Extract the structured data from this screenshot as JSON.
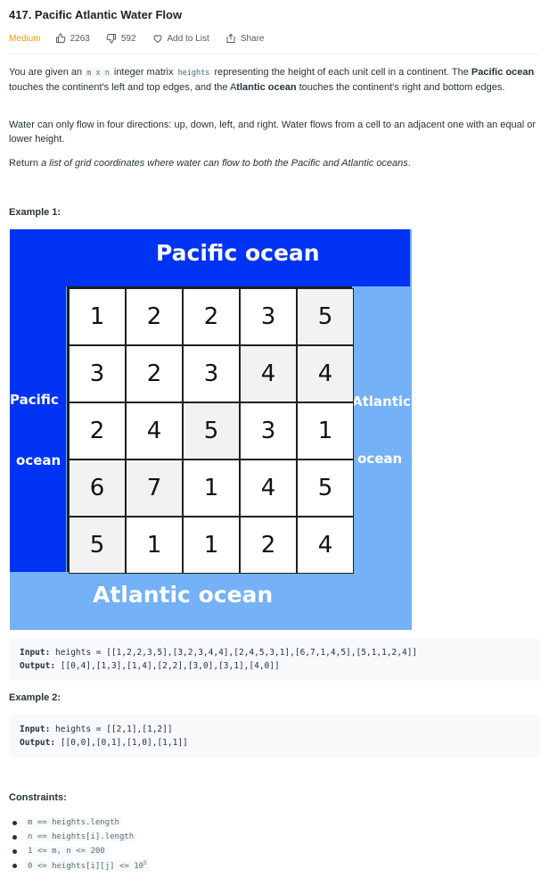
{
  "problem": {
    "title": "417. Pacific Atlantic Water Flow",
    "difficulty": "Medium",
    "likes": "2263",
    "dislikes": "592",
    "add_to_list": "Add to List",
    "share": "Share"
  },
  "description": {
    "p1": [
      {
        "t": "text",
        "v": "You are given an "
      },
      {
        "t": "code",
        "v": "m x n"
      },
      {
        "t": "text",
        "v": " integer matrix "
      },
      {
        "t": "code",
        "v": "heights"
      },
      {
        "t": "text",
        "v": " representing the height of each unit cell in a continent. The "
      },
      {
        "t": "bold",
        "v": "Pacific ocean"
      },
      {
        "t": "text",
        "v": " touches the continent's left and top edges, and the A"
      },
      {
        "t": "bold",
        "v": "tlantic ocean"
      },
      {
        "t": "text",
        "v": " touches the continent's right and bottom edges."
      }
    ],
    "p2": "Water can only flow in four directions: up, down, left, and right. Water flows from a cell to an adjacent one with an equal or lower height.",
    "p3_prefix": "Return ",
    "p3_italic": "a list of grid coordinates where water can flow to both the Pacific and Atlantic oceans",
    "p3_suffix": "."
  },
  "example1": {
    "title": "Example 1:",
    "figure": {
      "pacific_top": "Pacific ocean",
      "atlantic_bottom": "Atlantic ocean",
      "pacific_left_1": "Pacific",
      "pacific_left_2": "ocean",
      "atlantic_right_1": "Atlantic",
      "atlantic_right_2": "ocean",
      "grid": [
        [
          1,
          2,
          2,
          3,
          5
        ],
        [
          3,
          2,
          3,
          4,
          4
        ],
        [
          2,
          4,
          5,
          3,
          1
        ],
        [
          6,
          7,
          1,
          4,
          5
        ],
        [
          5,
          1,
          1,
          2,
          4
        ]
      ],
      "highlighted": [
        [
          0,
          4
        ],
        [
          1,
          3
        ],
        [
          1,
          4
        ],
        [
          2,
          2
        ],
        [
          3,
          0
        ],
        [
          3,
          1
        ],
        [
          4,
          0
        ]
      ],
      "colors": {
        "pacific": "#0033f4",
        "atlantic": "#74b1f6",
        "highlight": "#f2f2f2"
      }
    },
    "input_label": "Input:",
    "input_value": " heights = [[1,2,2,3,5],[3,2,3,4,4],[2,4,5,3,1],[6,7,1,4,5],[5,1,1,2,4]]",
    "output_label": "Output:",
    "output_value": " [[0,4],[1,3],[1,4],[2,2],[3,0],[3,1],[4,0]]"
  },
  "example2": {
    "title": "Example 2:",
    "input_label": "Input:",
    "input_value": " heights = [[2,1],[1,2]]",
    "output_label": "Output:",
    "output_value": " [[0,0],[0,1],[1,0],[1,1]]"
  },
  "constraints": {
    "title": "Constraints:",
    "items": [
      "m == heights.length",
      "n == heights[i].length",
      "1 <= m, n <= 200",
      "0 <= heights[i][j] <= 10"
    ],
    "last_superscript": "5"
  }
}
